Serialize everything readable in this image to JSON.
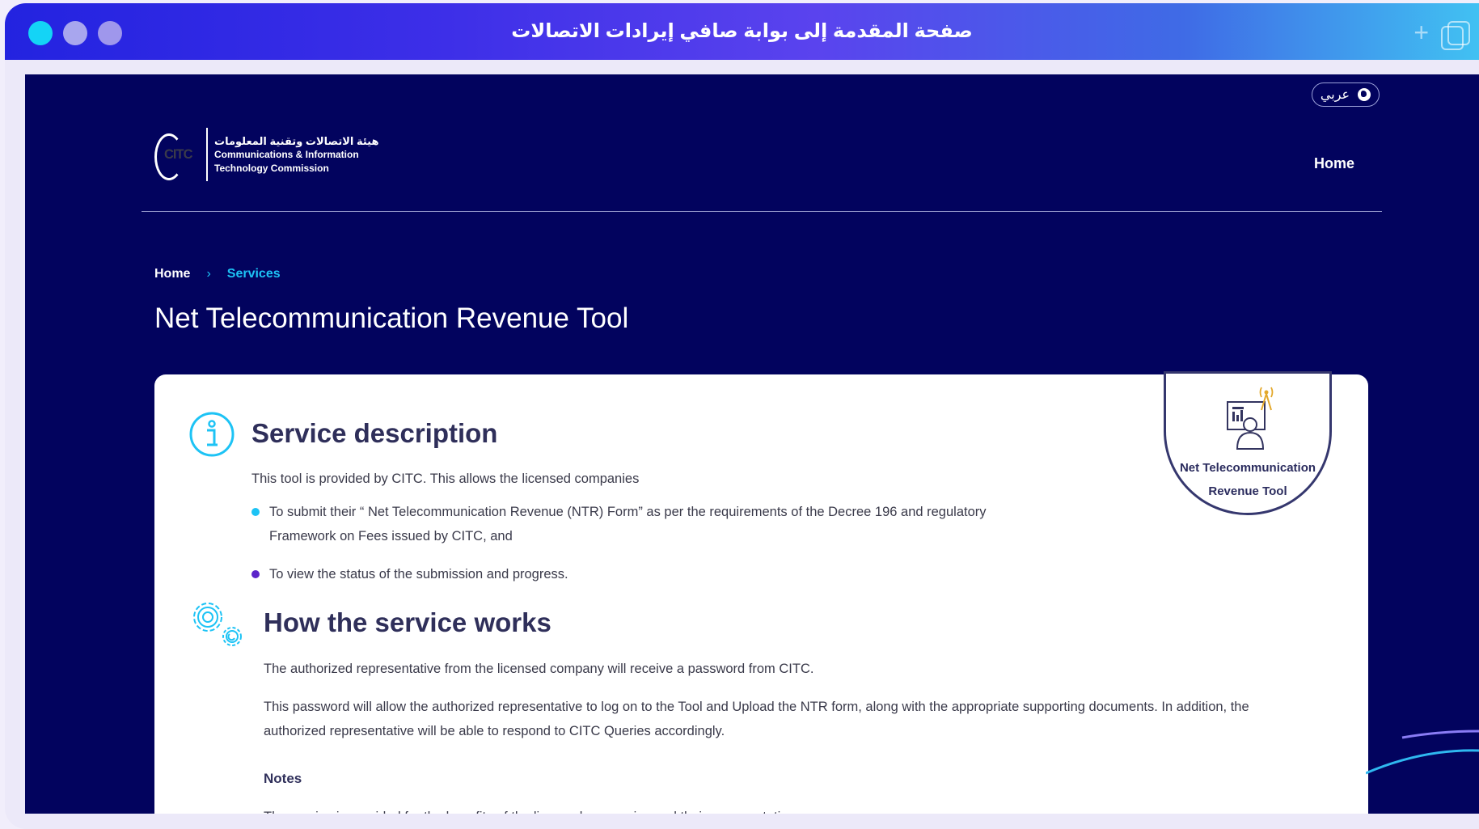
{
  "window": {
    "title": "صفحة المقدمة إلى بوابة صافي إيرادات الاتصالات",
    "new_tab_label": "+"
  },
  "header": {
    "language_button": "عربي",
    "logo": {
      "mark": "CITC",
      "arabic": "هيئة الاتصالات وتقنية المعلومات",
      "english_line1": "Communications & Information",
      "english_line2": "Technology Commission"
    },
    "nav_home": "Home"
  },
  "breadcrumb": {
    "home": "Home",
    "separator": "›",
    "current": "Services"
  },
  "page_title": "Net Telecommunication Revenue Tool",
  "badge": {
    "line1": "Net Telecommunication",
    "line2": "Revenue Tool"
  },
  "service_description": {
    "heading": "Service description",
    "intro": "This tool is provided by CITC. This allows the licensed companies",
    "bullets": [
      "To submit their “ Net Telecommunication Revenue (NTR) Form” as per the requirements of the Decree 196 and regulatory Framework on Fees issued by CITC, and",
      "To view the status of the submission and progress."
    ]
  },
  "how_it_works": {
    "heading": "How the service works",
    "paragraph1": "The authorized representative from the licensed company will receive a password from CITC.",
    "paragraph2": "This password will allow the authorized representative to log on to the Tool and Upload the NTR form, along with the appropriate supporting documents. In addition, the authorized representative will be able to respond to CITC Queries accordingly.",
    "notes_label": "Notes",
    "notes_text": "The service is provided for the benefits of the licensed companies and their representatives."
  },
  "colors": {
    "page_background": "#02035e",
    "accent_cyan": "#1dc3f5",
    "accent_purple": "#5b24c9",
    "heading_text": "#2f2f5a",
    "titlebar_start": "#2323e0",
    "titlebar_end": "#41c1f2"
  },
  "icons": [
    "info-icon",
    "gears-icon",
    "globe-icon",
    "telecom-worker-icon",
    "plus-icon",
    "copy-window-icon"
  ]
}
